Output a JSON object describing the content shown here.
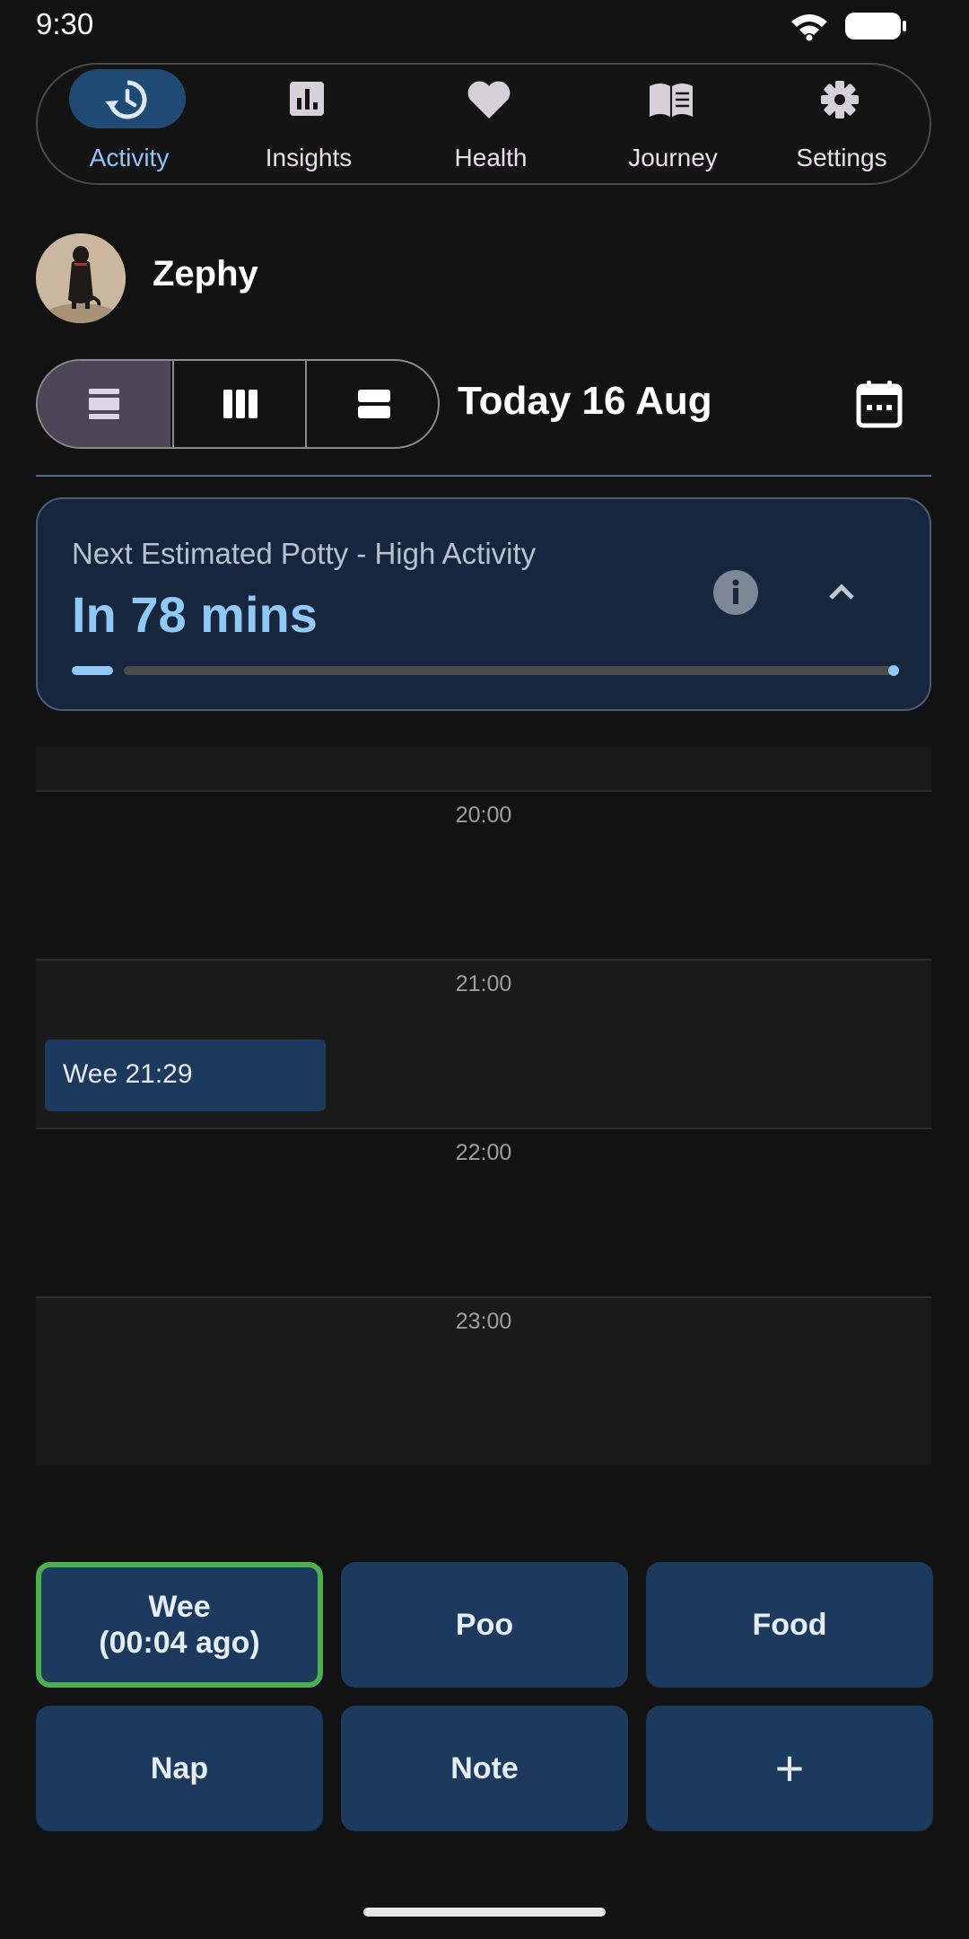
{
  "status_bar": {
    "time": "9:30"
  },
  "nav": {
    "items": [
      {
        "label": "Activity",
        "icon": "history-icon",
        "active": true
      },
      {
        "label": "Insights",
        "icon": "bar-chart-icon",
        "active": false
      },
      {
        "label": "Health",
        "icon": "heart-icon",
        "active": false
      },
      {
        "label": "Journey",
        "icon": "book-icon",
        "active": false
      },
      {
        "label": "Settings",
        "icon": "gear-icon",
        "active": false
      }
    ]
  },
  "profile": {
    "name": "Zephy"
  },
  "date_header": {
    "label": "Today 16 Aug"
  },
  "potty_card": {
    "title": "Next Estimated Potty - High Activity",
    "value": "In 78 mins",
    "progress": 0.05
  },
  "timeline": {
    "hours": [
      "20:00",
      "21:00",
      "22:00",
      "23:00"
    ],
    "events": [
      {
        "label": "Wee 21:29"
      }
    ]
  },
  "quick_actions": [
    {
      "label": "Wee\n(00:04 ago)"
    },
    {
      "label": "Poo"
    },
    {
      "label": "Food"
    },
    {
      "label": "Nap"
    },
    {
      "label": "Note"
    },
    {
      "label": "+"
    }
  ],
  "colors": {
    "background": "#121212",
    "accent": "#90c8f8",
    "card": "#16263d",
    "button": "#1b3a5e",
    "highlight_border": "#4caf50"
  }
}
